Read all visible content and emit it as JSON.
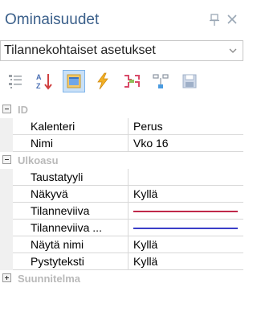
{
  "window": {
    "title": "Ominaisuudet"
  },
  "object_selector": {
    "selected": "Tilannekohtaiset asetukset"
  },
  "toolbar": {
    "buttons": [
      {
        "name": "categorized-icon"
      },
      {
        "name": "alphabetical-sort-icon"
      },
      {
        "name": "properties-icon",
        "active": true
      },
      {
        "name": "events-icon"
      },
      {
        "name": "property-pages-icon"
      },
      {
        "name": "hierarchy-icon"
      },
      {
        "name": "save-icon"
      }
    ]
  },
  "properties": {
    "categories": [
      {
        "label": "ID",
        "expanded": true,
        "rows": [
          {
            "name": "Kalenteri",
            "value": "Perus"
          },
          {
            "name": "Nimi",
            "value": "Vko 16"
          }
        ]
      },
      {
        "label": "Ulkoasu",
        "expanded": true,
        "rows": [
          {
            "name": "Taustatyyli",
            "value": ""
          },
          {
            "name": "Näkyvä",
            "value": "Kyllä"
          },
          {
            "name": "Tilanneviiva",
            "value": "",
            "line_color": "#c0294a"
          },
          {
            "name": "Tilanneviiva ...",
            "value": "",
            "line_color": "#3b3fc8"
          },
          {
            "name": "Näytä nimi",
            "value": "Kyllä"
          },
          {
            "name": "Pystyteksti",
            "value": "Kyllä"
          }
        ]
      },
      {
        "label": "Suunnitelma",
        "expanded": false,
        "rows": []
      }
    ]
  },
  "colors": {
    "title": "#3a5f8a",
    "category_text": "#b9b9b9",
    "grid_line": "#d8d8d8",
    "active_button": "#c9e0f7"
  }
}
